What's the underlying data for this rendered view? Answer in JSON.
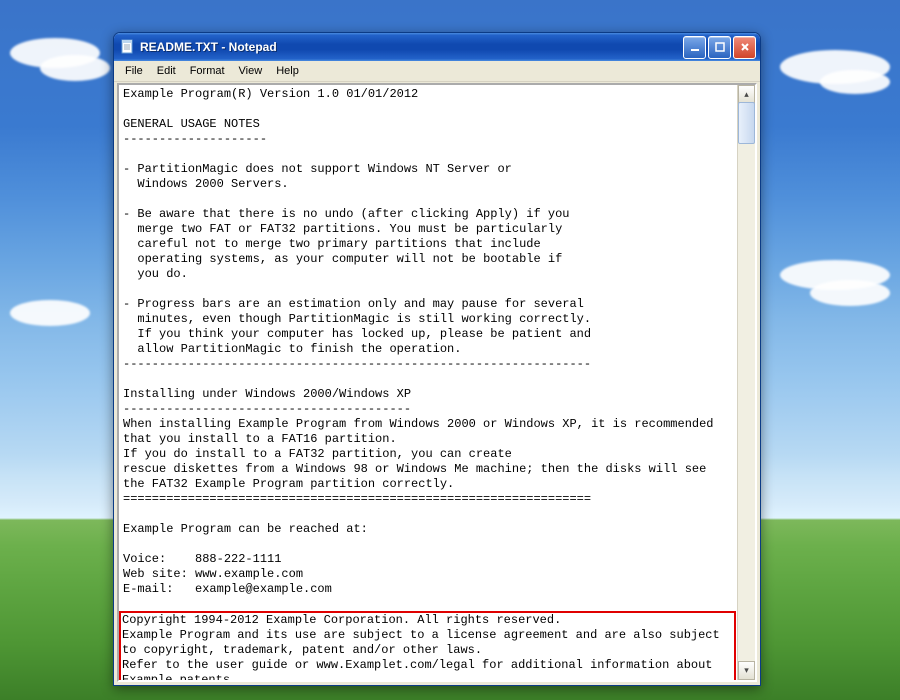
{
  "window": {
    "title": "README.TXT - Notepad",
    "icon": "notepad-icon",
    "buttons": {
      "min": "minimize",
      "max": "maximize",
      "close": "close"
    }
  },
  "menu": {
    "file": "File",
    "edit": "Edit",
    "format": "Format",
    "view": "View",
    "help": "Help"
  },
  "content": {
    "header": "Example Program(R) Version 1.0 01/01/2012",
    "sect1h": "GENERAL USAGE NOTES",
    "dash1": "--------------------",
    "bul1": "- PartitionMagic does not support Windows NT Server or\n  Windows 2000 Servers.",
    "bul2": "- Be aware that there is no undo (after clicking Apply) if you\n  merge two FAT or FAT32 partitions. You must be particularly\n  careful not to merge two primary partitions that include\n  operating systems, as your computer will not be bootable if\n  you do.",
    "bul3": "- Progress bars are an estimation only and may pause for several\n  minutes, even though PartitionMagic is still working correctly.\n  If you think your computer has locked up, please be patient and\n  allow PartitionMagic to finish the operation.",
    "dash2": "-----------------------------------------------------------------",
    "sect2h": "Installing under Windows 2000/Windows XP",
    "dash3": "----------------------------------------",
    "para2": "When installing Example Program from Windows 2000 or Windows XP, it is recommended that you install to a FAT16 partition.\nIf you do install to a FAT32 partition, you can create\nrescue diskettes from a Windows 98 or Windows Me machine; then the disks will see the FAT32 Example Program partition correctly.",
    "eqline": "=================================================================",
    "reach": "Example Program can be reached at:",
    "voice": "Voice:    888-222-1111",
    "web": "Web site: www.example.com",
    "email": "E-mail:   example@example.com",
    "legal": "Copyright 1994-2012 Example Corporation. All rights reserved.\nExample Program and its use are subject to a license agreement and are also subject to copyright, trademark, patent and/or other laws.\nRefer to the user guide or www.Examplet.com/legal for additional information about Example patents.\nAll other brand and product names are trademarks or registered"
  }
}
